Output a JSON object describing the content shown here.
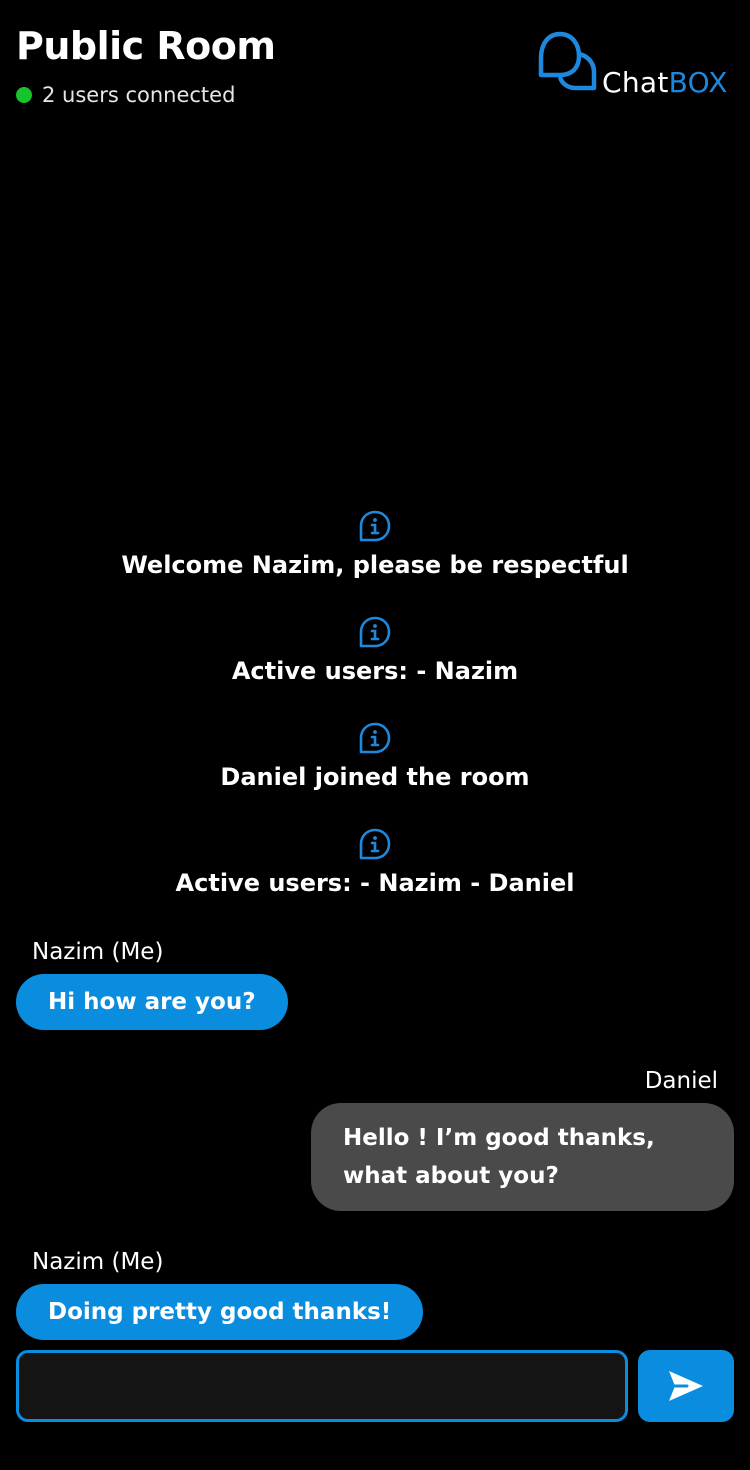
{
  "header": {
    "title": "Public Room",
    "status_text": "2 users connected",
    "status_color": "#18c42b"
  },
  "logo": {
    "text_chat": "Chat",
    "text_box": "BOX",
    "icon": "chat-bubbles-icon"
  },
  "notices": [
    {
      "icon": "info-icon",
      "text": "Welcome Nazim, please be respectful"
    },
    {
      "icon": "info-icon",
      "text": "Active users: - Nazim"
    },
    {
      "icon": "info-icon",
      "text": "Daniel joined the room"
    },
    {
      "icon": "info-icon",
      "text": "Active users: - Nazim - Daniel"
    }
  ],
  "messages": [
    {
      "sender": "Nazim (Me)",
      "text": "Hi how are you?",
      "mine": true
    },
    {
      "sender": "Daniel",
      "text": "Hello ! I’m good thanks, what about you?",
      "mine": false
    },
    {
      "sender": "Nazim (Me)",
      "text": "Doing pretty good thanks!",
      "mine": true
    }
  ],
  "composer": {
    "value": "",
    "placeholder": "",
    "send_icon": "send-icon"
  },
  "colors": {
    "accent": "#0b8ddf",
    "background": "#000000",
    "other_bubble": "#4a4a4a"
  }
}
